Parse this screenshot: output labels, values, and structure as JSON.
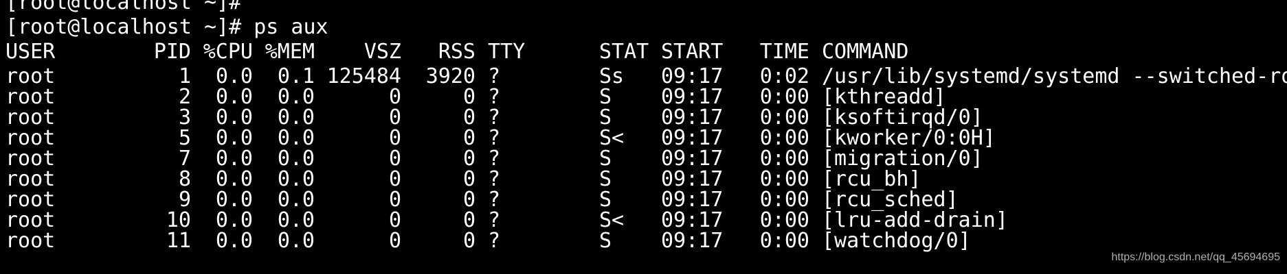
{
  "terminal": {
    "lines": [
      "[root@localhost ~]#",
      "[root@localhost ~]# ps aux"
    ],
    "header": {
      "user": "USER",
      "pid": "PID",
      "cpu": "%CPU",
      "mem": "%MEM",
      "vsz": "VSZ",
      "rss": "RSS",
      "tty": "TTY",
      "stat": "STAT",
      "start": "START",
      "time": "TIME",
      "command": "COMMAND"
    },
    "rows": [
      {
        "user": "root",
        "pid": "1",
        "cpu": "0.0",
        "mem": "0.1",
        "vsz": "125484",
        "rss": "3920",
        "tty": "?",
        "stat": "Ss",
        "start": "09:17",
        "time": "0:02",
        "command": "/usr/lib/systemd/systemd --switched-ro"
      },
      {
        "user": "root",
        "pid": "2",
        "cpu": "0.0",
        "mem": "0.0",
        "vsz": "0",
        "rss": "0",
        "tty": "?",
        "stat": "S",
        "start": "09:17",
        "time": "0:00",
        "command": "[kthreadd]"
      },
      {
        "user": "root",
        "pid": "3",
        "cpu": "0.0",
        "mem": "0.0",
        "vsz": "0",
        "rss": "0",
        "tty": "?",
        "stat": "S",
        "start": "09:17",
        "time": "0:00",
        "command": "[ksoftirqd/0]"
      },
      {
        "user": "root",
        "pid": "5",
        "cpu": "0.0",
        "mem": "0.0",
        "vsz": "0",
        "rss": "0",
        "tty": "?",
        "stat": "S<",
        "start": "09:17",
        "time": "0:00",
        "command": "[kworker/0:0H]"
      },
      {
        "user": "root",
        "pid": "7",
        "cpu": "0.0",
        "mem": "0.0",
        "vsz": "0",
        "rss": "0",
        "tty": "?",
        "stat": "S",
        "start": "09:17",
        "time": "0:00",
        "command": "[migration/0]"
      },
      {
        "user": "root",
        "pid": "8",
        "cpu": "0.0",
        "mem": "0.0",
        "vsz": "0",
        "rss": "0",
        "tty": "?",
        "stat": "S",
        "start": "09:17",
        "time": "0:00",
        "command": "[rcu_bh]"
      },
      {
        "user": "root",
        "pid": "9",
        "cpu": "0.0",
        "mem": "0.0",
        "vsz": "0",
        "rss": "0",
        "tty": "?",
        "stat": "S",
        "start": "09:17",
        "time": "0:00",
        "command": "[rcu_sched]"
      },
      {
        "user": "root",
        "pid": "10",
        "cpu": "0.0",
        "mem": "0.0",
        "vsz": "0",
        "rss": "0",
        "tty": "?",
        "stat": "S<",
        "start": "09:17",
        "time": "0:00",
        "command": "[lru-add-drain]"
      },
      {
        "user": "root",
        "pid": "11",
        "cpu": "0.0",
        "mem": "0.0",
        "vsz": "0",
        "rss": "0",
        "tty": "?",
        "stat": "S",
        "start": "09:17",
        "time": "0:00",
        "command": "[watchdog/0]"
      }
    ]
  },
  "watermark": "https://blog.csdn.net/qq_45694695",
  "colors": {
    "background": "#000000",
    "foreground": "#ffffff",
    "watermark": "#b0b0b0"
  }
}
